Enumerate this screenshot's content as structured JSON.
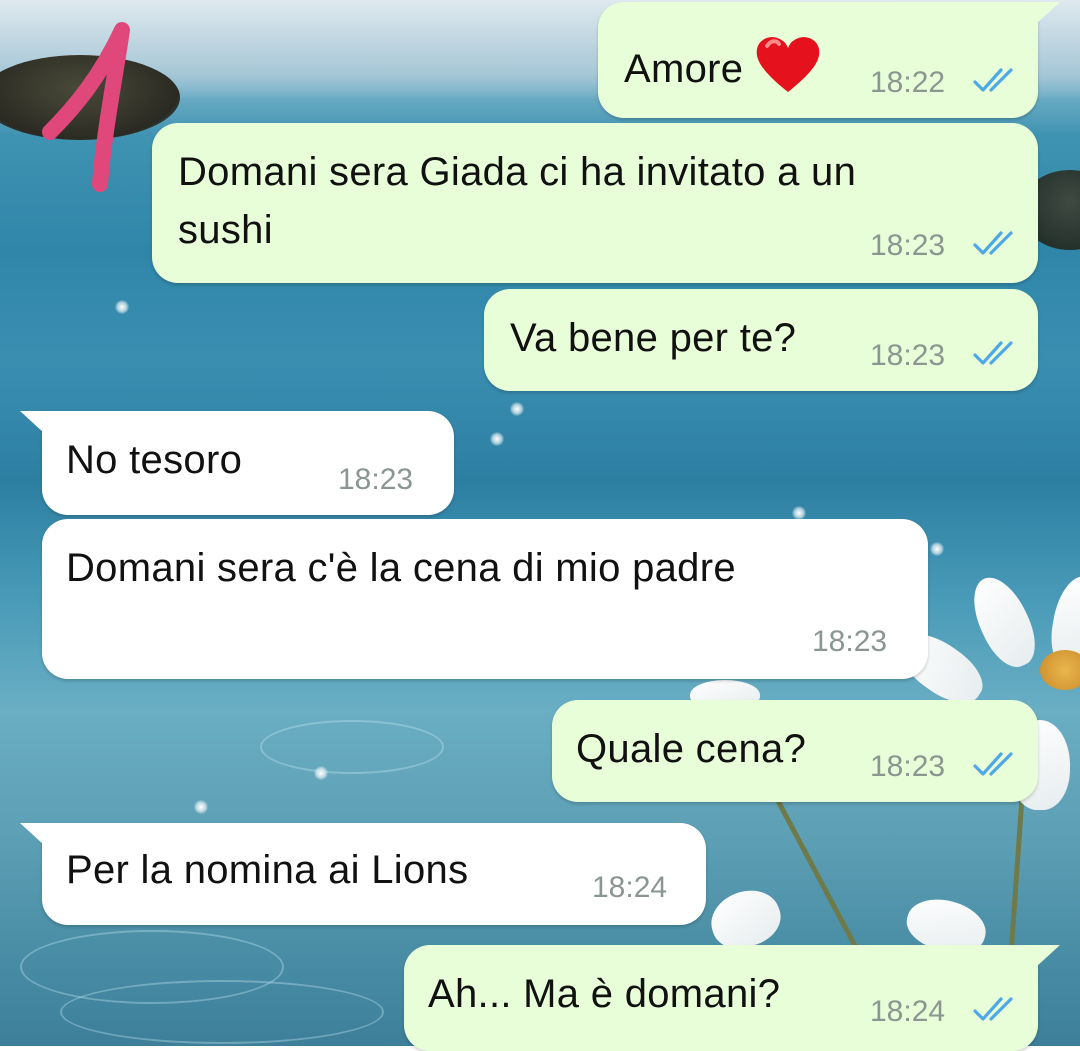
{
  "theme": {
    "outgoing_bubble": "#e7fed9",
    "incoming_bubble": "#ffffff",
    "read_ticks": "#4fa8e6",
    "annotation_mark": "#e0487b"
  },
  "annotation": {
    "icon": "pink-handwritten-number-mark"
  },
  "messages": [
    {
      "direction": "outgoing",
      "text": "Amore",
      "emoji": "red-heart",
      "time": "18:22",
      "status": "read"
    },
    {
      "direction": "outgoing",
      "text_lines": [
        "Domani sera Giada ci ha invitato a un",
        "sushi"
      ],
      "time": "18:23",
      "status": "read"
    },
    {
      "direction": "outgoing",
      "text": "Va bene per te?",
      "time": "18:23",
      "status": "read"
    },
    {
      "direction": "incoming",
      "text": "No tesoro",
      "time": "18:23"
    },
    {
      "direction": "incoming",
      "text": "Domani sera c'è la cena di mio padre",
      "time": "18:23"
    },
    {
      "direction": "outgoing",
      "text": "Quale cena?",
      "time": "18:23",
      "status": "read"
    },
    {
      "direction": "incoming",
      "text": "Per la nomina ai Lions",
      "time": "18:24"
    },
    {
      "direction": "outgoing",
      "text": "Ah... Ma è domani?",
      "time": "18:24",
      "status": "read"
    }
  ]
}
